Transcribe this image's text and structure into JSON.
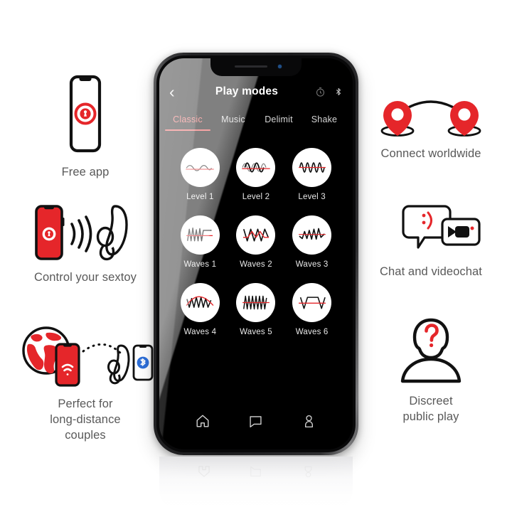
{
  "brand": {
    "red": "#E5262A",
    "red_dark": "#D81F26",
    "blue": "#2E6FD8",
    "text_gray": "#595959"
  },
  "features": {
    "left": [
      {
        "id": "free-app",
        "icon": "phone-with-app-logo-icon",
        "caption": "Free app"
      },
      {
        "id": "control-sextoy",
        "icon": "phone-signal-to-toy-icon",
        "caption": "Control your sextoy"
      },
      {
        "id": "long-distance",
        "icon": "globe-phone-toy-bluetooth-icon",
        "caption": "Perfect for\nlong-distance\ncouples"
      }
    ],
    "right": [
      {
        "id": "connect-worldwide",
        "icon": "two-map-pins-arc-icon",
        "caption": "Connect worldwide"
      },
      {
        "id": "chat-videochat",
        "icon": "speech-bubble-video-camera-icon",
        "caption": "Chat and videochat"
      },
      {
        "id": "discreet-public-play",
        "icon": "anonymous-person-question-icon",
        "caption": "Discreet\npublic play"
      }
    ]
  },
  "phone": {
    "header": {
      "back_icon": "chevron-left-icon",
      "title": "Play modes",
      "timer_icon": "timer-icon",
      "bluetooth_icon": "bluetooth-icon"
    },
    "tabs": [
      {
        "label": "Classic",
        "active": true
      },
      {
        "label": "Music",
        "active": false
      },
      {
        "label": "Delimit",
        "active": false
      },
      {
        "label": "Shake",
        "active": false
      }
    ],
    "modes": [
      {
        "label": "Level 1",
        "wave": "low-smooth-sine-icon"
      },
      {
        "label": "Level 2",
        "wave": "medium-sine-icon"
      },
      {
        "label": "Level 3",
        "wave": "high-dense-sine-icon"
      },
      {
        "label": "Waves 1",
        "wave": "burst-then-flat-icon"
      },
      {
        "label": "Waves 2",
        "wave": "v-peaks-icon"
      },
      {
        "label": "Waves 3",
        "wave": "rising-zigzag-icon"
      },
      {
        "label": "Waves 4",
        "wave": "arch-zigzag-icon"
      },
      {
        "label": "Waves 5",
        "wave": "sawtooth-icon"
      },
      {
        "label": "Waves 6",
        "wave": "trapezoid-plateau-icon"
      }
    ],
    "bottom_nav": [
      {
        "icon": "home-icon",
        "label": "Home"
      },
      {
        "icon": "chat-bubble-icon",
        "label": "Chat"
      },
      {
        "icon": "profile-icon",
        "label": "Profile"
      }
    ]
  }
}
